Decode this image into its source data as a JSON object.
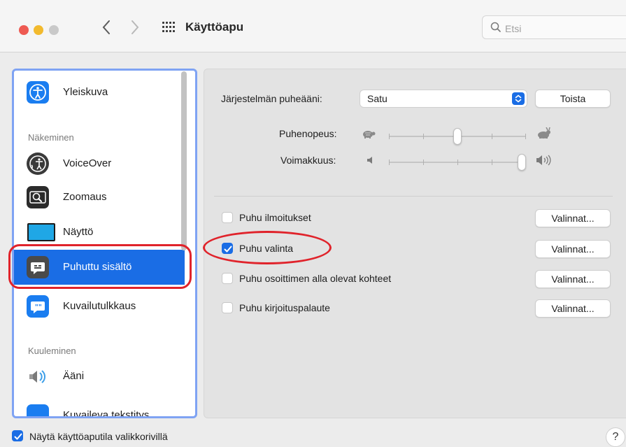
{
  "window": {
    "title": "Käyttöapu",
    "search_placeholder": "Etsi"
  },
  "sidebar": {
    "items": [
      {
        "label": "Yleiskuva",
        "icon": "accessibility-icon"
      },
      {
        "label": "VoiceOver",
        "icon": "voiceover-icon"
      },
      {
        "label": "Zoomaus",
        "icon": "zoom-icon"
      },
      {
        "label": "Näyttö",
        "icon": "display-icon"
      },
      {
        "label": "Puhuttu sisältö",
        "icon": "spoken-content-icon",
        "selected": true
      },
      {
        "label": "Kuvailutulkkaus",
        "icon": "audio-description-icon"
      },
      {
        "label": "Ääni",
        "icon": "speaker-icon"
      },
      {
        "label": "Kuvaileva tekstitys",
        "icon": "captions-icon"
      }
    ],
    "sections": {
      "vision": "Näkeminen",
      "hearing": "Kuuleminen"
    }
  },
  "main": {
    "voice_label": "Järjestelmän puheääni:",
    "voice_value": "Satu",
    "play_button": "Toista",
    "rate_label": "Puhenopeus:",
    "rate_level": 0.5,
    "volume_label": "Voimakkuus:",
    "volume_level": 1.0,
    "options": [
      {
        "label": "Puhu ilmoitukset",
        "checked": false,
        "button": "Valinnat..."
      },
      {
        "label": "Puhu valinta",
        "checked": true,
        "button": "Valinnat..."
      },
      {
        "label": "Puhu osoittimen alla olevat kohteet",
        "checked": false,
        "button": "Valinnat..."
      },
      {
        "label": "Puhu kirjoituspalaute",
        "checked": false,
        "button": "Valinnat..."
      }
    ]
  },
  "footer": {
    "menu_bar_label": "Näytä käyttöaputila valikkorivillä",
    "menu_bar_checked": true,
    "help": "?"
  },
  "colors": {
    "accent": "#1a6de5",
    "annotation": "#e0232b"
  }
}
